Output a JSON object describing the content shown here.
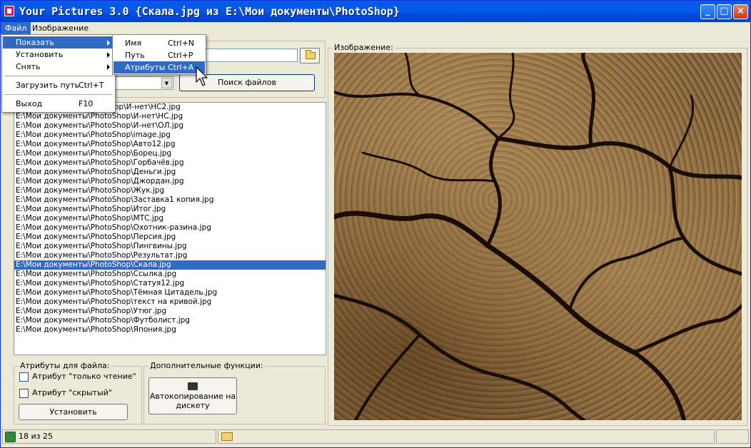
{
  "window": {
    "title": "Your Pictures 3.0 {Скала.jpg из E:\\Мои документы\\PhotoShop}",
    "controls": {
      "minimize": "_",
      "maximize": "□",
      "close": "×"
    }
  },
  "menubar": {
    "file": "Файл",
    "image": "Изображение"
  },
  "file_menu": {
    "show": "Показать",
    "set": "Установить",
    "remove": "Снять",
    "load_path": "Загрузить путь",
    "load_path_shortcut": "Ctrl+T",
    "exit": "Выход",
    "exit_shortcut": "F10"
  },
  "show_submenu": {
    "name": "Имя",
    "name_shortcut": "Ctrl+N",
    "path": "Путь",
    "path_shortcut": "Ctrl+P",
    "attributes": "Атрибуты",
    "attributes_shortcut": "Ctrl+A"
  },
  "search_button": "Поиск файлов",
  "files": {
    "first_partial": "ор\\И-нет\\НС2.jpg",
    "items": [
      "E:\\Мои документы\\PhotoShop\\И-нет\\НС.jpg",
      "E:\\Мои документы\\PhotoShop\\И-нет\\ОЛ.jpg",
      "E:\\Мои документы\\PhotoShop\\image.jpg",
      "E:\\Мои документы\\PhotoShop\\Авто12.jpg",
      "E:\\Мои документы\\PhotoShop\\Борец.jpg",
      "E:\\Мои документы\\PhotoShop\\Горбачёв.jpg",
      "E:\\Мои документы\\PhotoShop\\Деньги.jpg",
      "E:\\Мои документы\\PhotoShop\\Джордан.jpg",
      "E:\\Мои документы\\PhotoShop\\Жук.jpg",
      "E:\\Мои документы\\PhotoShop\\Заставка1 копия.jpg",
      "E:\\Мои документы\\PhotoShop\\Итог.jpg",
      "E:\\Мои документы\\PhotoShop\\МТС.jpg",
      "E:\\Мои документы\\PhotoShop\\Охотник-разина.jpg",
      "E:\\Мои документы\\PhotoShop\\Персия.jpg",
      "E:\\Мои документы\\PhotoShop\\Пингвины.jpg",
      "E:\\Мои документы\\PhotoShop\\Результат.jpg",
      "E:\\Мои документы\\PhotoShop\\Скала.jpg",
      "E:\\Мои документы\\PhotoShop\\Ссылка.jpg",
      "E:\\Мои документы\\PhotoShop\\Статуя12.jpg",
      "E:\\Мои документы\\PhotoShop\\Тёмная Цитадель.jpg",
      "E:\\Мои документы\\PhotoShop\\текст на кривой.jpg",
      "E:\\Мои документы\\PhotoShop\\Утюг.jpg",
      "E:\\Мои документы\\PhotoShop\\Футболист.jpg",
      "E:\\Мои документы\\PhotoShop\\Япония.jpg"
    ],
    "selected_index": 16
  },
  "attributes_group": {
    "label": "Атрибуты для файла:",
    "readonly": "Атрибут \"только чтение\"",
    "hidden": "Атрибут \"скрытый\"",
    "set_button": "Установить"
  },
  "extra_group": {
    "label": "Дополнительные функции:",
    "autocopy_line1": "Автокопирование на",
    "autocopy_line2": "дискету"
  },
  "image_group": {
    "label": "Изображение:"
  },
  "status": {
    "count": "18 из 25"
  },
  "colors": {
    "titlebar": "#0058ee",
    "selection": "#316ac5",
    "face": "#ece9d8"
  }
}
